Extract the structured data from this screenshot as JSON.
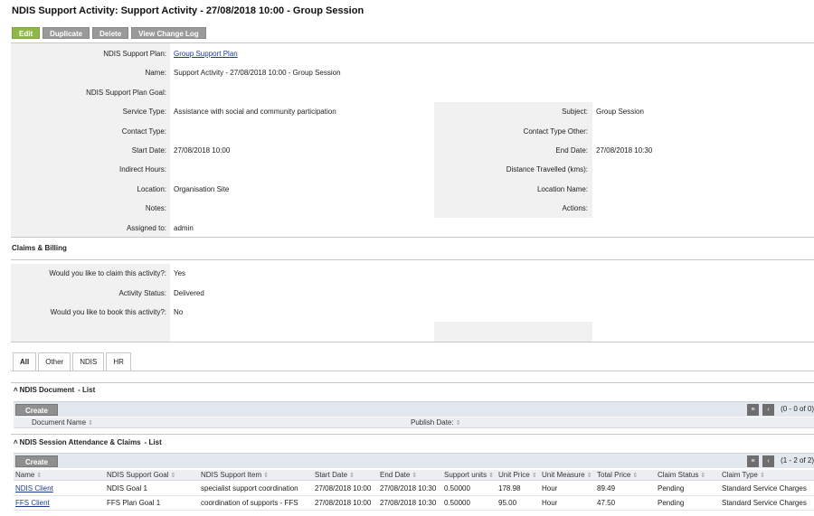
{
  "page": {
    "title": "NDIS Support Activity: Support Activity - 27/08/2018 10:00 - Group Session"
  },
  "toolbar": {
    "edit": "Edit",
    "duplicate": "Duplicate",
    "delete": "Delete",
    "changelog": "View Change Log"
  },
  "details": {
    "plan_label": "NDIS Support Plan:",
    "plan_value": "Group Support Plan",
    "name_label": "Name:",
    "name_value": "Support Activity - 27/08/2018 10:00 - Group Session",
    "goal_label": "NDIS Support Plan Goal:",
    "service_label": "Service Type:",
    "service_value": "Assistance with social and community participation",
    "contact_label": "Contact Type:",
    "start_label": "Start Date:",
    "start_value": "27/08/2018 10:00",
    "indirect_label": "Indirect Hours:",
    "location_label": "Location:",
    "location_value": "Organisation Site",
    "notes_label": "Notes:",
    "assigned_label": "Assigned to:",
    "assigned_value": "admin",
    "subject_label": "Subject:",
    "subject_value": "Group Session",
    "contact_other_label": "Contact Type Other:",
    "end_label": "End Date:",
    "end_value": "27/08/2018 10:30",
    "distance_label": "Distance Travelled (kms):",
    "location_name_label": "Location Name:",
    "actions_label": "Actions:"
  },
  "claims": {
    "heading": "Claims & Billing",
    "claim_label": "Would you like to claim this activity?:",
    "claim_value": "Yes",
    "status_label": "Activity Status:",
    "status_value": "Delivered",
    "book_label": "Would you like to book this activity?:",
    "book_value": "No"
  },
  "tabs": [
    "All",
    "Other",
    "NDIS",
    "HR"
  ],
  "documents": {
    "title": "NDIS Document",
    "subtitle": "- List",
    "create": "Create",
    "pager": "(0 - 0 of 0)",
    "columns": [
      "Document Name",
      "Publish Date:"
    ]
  },
  "attendance": {
    "title": "NDIS Session Attendance & Claims",
    "subtitle": "- List",
    "create": "Create",
    "pager": "(1 - 2 of 2)",
    "columns": [
      "Name",
      "NDIS Support Goal",
      "NDIS Support Item",
      "Start Date",
      "End Date",
      "Support units",
      "Unit Price",
      "Unit Measure",
      "Total Price",
      "Claim Status",
      "Claim Type"
    ],
    "rows": [
      [
        "NDIS Client",
        "NDIS Goal 1",
        "specialist support coordination",
        "27/08/2018 10:00",
        "27/08/2018 10:30",
        "0.50000",
        "178.98",
        "Hour",
        "89.49",
        "Pending",
        "Standard Service Charges"
      ],
      [
        "FFS Client",
        "FFS Plan Goal 1",
        "coordination of supports - FFS",
        "27/08/2018 10:00",
        "27/08/2018 10:30",
        "0.50000",
        "95.00",
        "Hour",
        "47.50",
        "Pending",
        "Standard Service Charges"
      ]
    ]
  },
  "icons": {
    "sort": "sort-arrows-icon",
    "collapse": "double-chevron-up-icon",
    "columns": "column-chooser-icon",
    "prev": "chevron-left-icon"
  },
  "colors": {
    "edit_button": "#90b849",
    "gray_button": "#9a9a9a",
    "link": "#1a3c8a",
    "panel": "#f1f1f1"
  }
}
